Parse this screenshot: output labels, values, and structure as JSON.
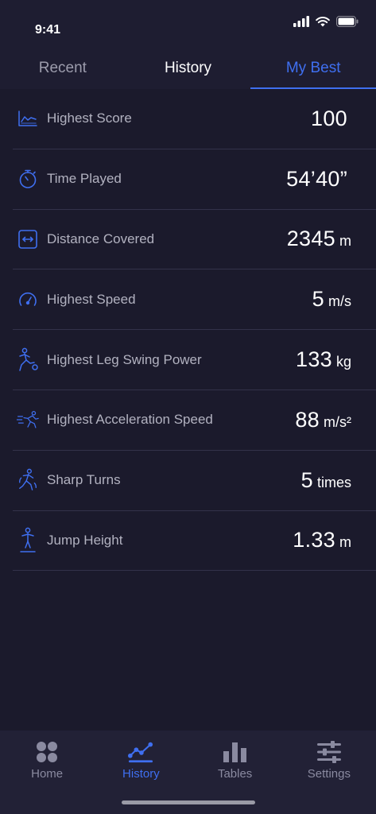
{
  "status": {
    "time": "9:41"
  },
  "tabs": [
    {
      "label": "Recent"
    },
    {
      "label": "History"
    },
    {
      "label": "My Best"
    }
  ],
  "stats": [
    {
      "icon": "line-chart-icon",
      "label": "Highest Score",
      "value": "100",
      "unit": ""
    },
    {
      "icon": "stopwatch-icon",
      "label": "Time Played",
      "value": "54’40”",
      "unit": ""
    },
    {
      "icon": "distance-arrows-icon",
      "label": "Distance Covered",
      "value": "2345",
      "unit": "m"
    },
    {
      "icon": "speedometer-icon",
      "label": "Highest Speed",
      "value": "5",
      "unit": "m/s"
    },
    {
      "icon": "kicking-player-icon",
      "label": "Highest Leg Swing Power",
      "value": "133",
      "unit": "kg"
    },
    {
      "icon": "sprinting-player-icon",
      "label": "Highest Acceleration Speed",
      "value": "88",
      "unit": "m/s²"
    },
    {
      "icon": "turning-player-icon",
      "label": "Sharp Turns",
      "value": "5",
      "unit": "times"
    },
    {
      "icon": "jumping-player-icon",
      "label": "Jump Height",
      "value": "1.33",
      "unit": "m"
    }
  ],
  "nav": [
    {
      "icon": "home-grid-icon",
      "label": "Home"
    },
    {
      "icon": "history-line-icon",
      "label": "History"
    },
    {
      "icon": "tables-bar-icon",
      "label": "Tables"
    },
    {
      "icon": "settings-sliders-icon",
      "label": "Settings"
    }
  ],
  "colors": {
    "accent": "#3f6ff0",
    "background": "#1b1a2c",
    "nav_inactive": "#8a8aa0"
  }
}
